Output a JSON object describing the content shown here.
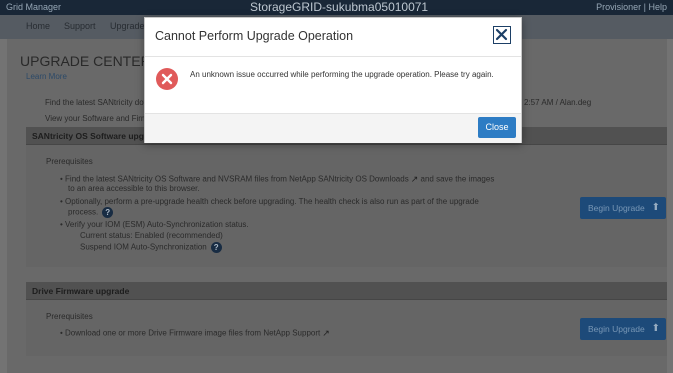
{
  "topbar": {
    "app_name": "Grid Manager",
    "title": "StorageGRID-sukubma05010071",
    "user": "Provisioner | Help"
  },
  "nav": {
    "items": [
      "Home",
      "Support",
      "Upgrade"
    ]
  },
  "page": {
    "title": "UPGRADE CENTER",
    "learn_more": "Learn More",
    "find_line": "Find the latest SANtricity downloads",
    "view_line": "View your Software and Firmware",
    "right_info": "2:57 AM / Alan.deg"
  },
  "os_section": {
    "title": "SANtricity OS Software upgrade",
    "prereq": "Prerequisites",
    "bullets": [
      "Find the latest SANtricity OS Software and NVSRAM files from NetApp SANtricity OS Downloads",
      "and save the images",
      "to an area accessible to this browser.",
      "Optionally, perform a pre-upgrade health check before upgrading. The health check is also run as part of the upgrade",
      "process.",
      "Verify your IOM (ESM) Auto-Synchronization status.",
      "Current status: Enabled (recommended)",
      "Suspend IOM Auto-Synchronization"
    ],
    "begin_label": "Begin Upgrade"
  },
  "drive_section": {
    "title": "Drive Firmware upgrade",
    "prereq": "Prerequisites",
    "bullet": "Download one or more Drive Firmware image files from NetApp Support",
    "begin_label": "Begin Upgrade"
  },
  "modal": {
    "title": "Cannot Perform Upgrade Operation",
    "message": "An unknown issue occurred while performing the upgrade operation. Please try again.",
    "close_label": "Close"
  },
  "colors": {
    "accent": "#2d7cc4",
    "error": "#e05a5a",
    "close_icon": "#1c3f66"
  },
  "icons": [
    "help-icon",
    "external-link-icon",
    "upload-icon",
    "error-icon",
    "close-icon"
  ]
}
